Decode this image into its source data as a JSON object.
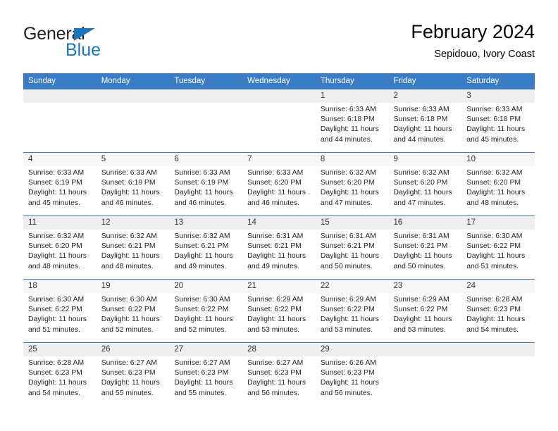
{
  "brand": {
    "name_part1": "General",
    "name_part2": "Blue",
    "accent_color": "#1b75bb"
  },
  "header": {
    "title": "February 2024",
    "subtitle": "Sepidouo, Ivory Coast"
  },
  "calendar": {
    "header_color": "#3b7dc4",
    "weekday_headers": [
      "Sunday",
      "Monday",
      "Tuesday",
      "Wednesday",
      "Thursday",
      "Friday",
      "Saturday"
    ],
    "weeks": [
      [
        {
          "day": "",
          "lines": []
        },
        {
          "day": "",
          "lines": []
        },
        {
          "day": "",
          "lines": []
        },
        {
          "day": "",
          "lines": []
        },
        {
          "day": "1",
          "lines": [
            "Sunrise: 6:33 AM",
            "Sunset: 6:18 PM",
            "Daylight: 11 hours",
            "and 44 minutes."
          ]
        },
        {
          "day": "2",
          "lines": [
            "Sunrise: 6:33 AM",
            "Sunset: 6:18 PM",
            "Daylight: 11 hours",
            "and 44 minutes."
          ]
        },
        {
          "day": "3",
          "lines": [
            "Sunrise: 6:33 AM",
            "Sunset: 6:18 PM",
            "Daylight: 11 hours",
            "and 45 minutes."
          ]
        }
      ],
      [
        {
          "day": "4",
          "lines": [
            "Sunrise: 6:33 AM",
            "Sunset: 6:19 PM",
            "Daylight: 11 hours",
            "and 45 minutes."
          ]
        },
        {
          "day": "5",
          "lines": [
            "Sunrise: 6:33 AM",
            "Sunset: 6:19 PM",
            "Daylight: 11 hours",
            "and 46 minutes."
          ]
        },
        {
          "day": "6",
          "lines": [
            "Sunrise: 6:33 AM",
            "Sunset: 6:19 PM",
            "Daylight: 11 hours",
            "and 46 minutes."
          ]
        },
        {
          "day": "7",
          "lines": [
            "Sunrise: 6:33 AM",
            "Sunset: 6:20 PM",
            "Daylight: 11 hours",
            "and 46 minutes."
          ]
        },
        {
          "day": "8",
          "lines": [
            "Sunrise: 6:32 AM",
            "Sunset: 6:20 PM",
            "Daylight: 11 hours",
            "and 47 minutes."
          ]
        },
        {
          "day": "9",
          "lines": [
            "Sunrise: 6:32 AM",
            "Sunset: 6:20 PM",
            "Daylight: 11 hours",
            "and 47 minutes."
          ]
        },
        {
          "day": "10",
          "lines": [
            "Sunrise: 6:32 AM",
            "Sunset: 6:20 PM",
            "Daylight: 11 hours",
            "and 48 minutes."
          ]
        }
      ],
      [
        {
          "day": "11",
          "lines": [
            "Sunrise: 6:32 AM",
            "Sunset: 6:20 PM",
            "Daylight: 11 hours",
            "and 48 minutes."
          ]
        },
        {
          "day": "12",
          "lines": [
            "Sunrise: 6:32 AM",
            "Sunset: 6:21 PM",
            "Daylight: 11 hours",
            "and 48 minutes."
          ]
        },
        {
          "day": "13",
          "lines": [
            "Sunrise: 6:32 AM",
            "Sunset: 6:21 PM",
            "Daylight: 11 hours",
            "and 49 minutes."
          ]
        },
        {
          "day": "14",
          "lines": [
            "Sunrise: 6:31 AM",
            "Sunset: 6:21 PM",
            "Daylight: 11 hours",
            "and 49 minutes."
          ]
        },
        {
          "day": "15",
          "lines": [
            "Sunrise: 6:31 AM",
            "Sunset: 6:21 PM",
            "Daylight: 11 hours",
            "and 50 minutes."
          ]
        },
        {
          "day": "16",
          "lines": [
            "Sunrise: 6:31 AM",
            "Sunset: 6:21 PM",
            "Daylight: 11 hours",
            "and 50 minutes."
          ]
        },
        {
          "day": "17",
          "lines": [
            "Sunrise: 6:30 AM",
            "Sunset: 6:22 PM",
            "Daylight: 11 hours",
            "and 51 minutes."
          ]
        }
      ],
      [
        {
          "day": "18",
          "lines": [
            "Sunrise: 6:30 AM",
            "Sunset: 6:22 PM",
            "Daylight: 11 hours",
            "and 51 minutes."
          ]
        },
        {
          "day": "19",
          "lines": [
            "Sunrise: 6:30 AM",
            "Sunset: 6:22 PM",
            "Daylight: 11 hours",
            "and 52 minutes."
          ]
        },
        {
          "day": "20",
          "lines": [
            "Sunrise: 6:30 AM",
            "Sunset: 6:22 PM",
            "Daylight: 11 hours",
            "and 52 minutes."
          ]
        },
        {
          "day": "21",
          "lines": [
            "Sunrise: 6:29 AM",
            "Sunset: 6:22 PM",
            "Daylight: 11 hours",
            "and 53 minutes."
          ]
        },
        {
          "day": "22",
          "lines": [
            "Sunrise: 6:29 AM",
            "Sunset: 6:22 PM",
            "Daylight: 11 hours",
            "and 53 minutes."
          ]
        },
        {
          "day": "23",
          "lines": [
            "Sunrise: 6:29 AM",
            "Sunset: 6:22 PM",
            "Daylight: 11 hours",
            "and 53 minutes."
          ]
        },
        {
          "day": "24",
          "lines": [
            "Sunrise: 6:28 AM",
            "Sunset: 6:23 PM",
            "Daylight: 11 hours",
            "and 54 minutes."
          ]
        }
      ],
      [
        {
          "day": "25",
          "lines": [
            "Sunrise: 6:28 AM",
            "Sunset: 6:23 PM",
            "Daylight: 11 hours",
            "and 54 minutes."
          ]
        },
        {
          "day": "26",
          "lines": [
            "Sunrise: 6:27 AM",
            "Sunset: 6:23 PM",
            "Daylight: 11 hours",
            "and 55 minutes."
          ]
        },
        {
          "day": "27",
          "lines": [
            "Sunrise: 6:27 AM",
            "Sunset: 6:23 PM",
            "Daylight: 11 hours",
            "and 55 minutes."
          ]
        },
        {
          "day": "28",
          "lines": [
            "Sunrise: 6:27 AM",
            "Sunset: 6:23 PM",
            "Daylight: 11 hours",
            "and 56 minutes."
          ]
        },
        {
          "day": "29",
          "lines": [
            "Sunrise: 6:26 AM",
            "Sunset: 6:23 PM",
            "Daylight: 11 hours",
            "and 56 minutes."
          ]
        },
        {
          "day": "",
          "lines": []
        },
        {
          "day": "",
          "lines": []
        }
      ]
    ]
  }
}
